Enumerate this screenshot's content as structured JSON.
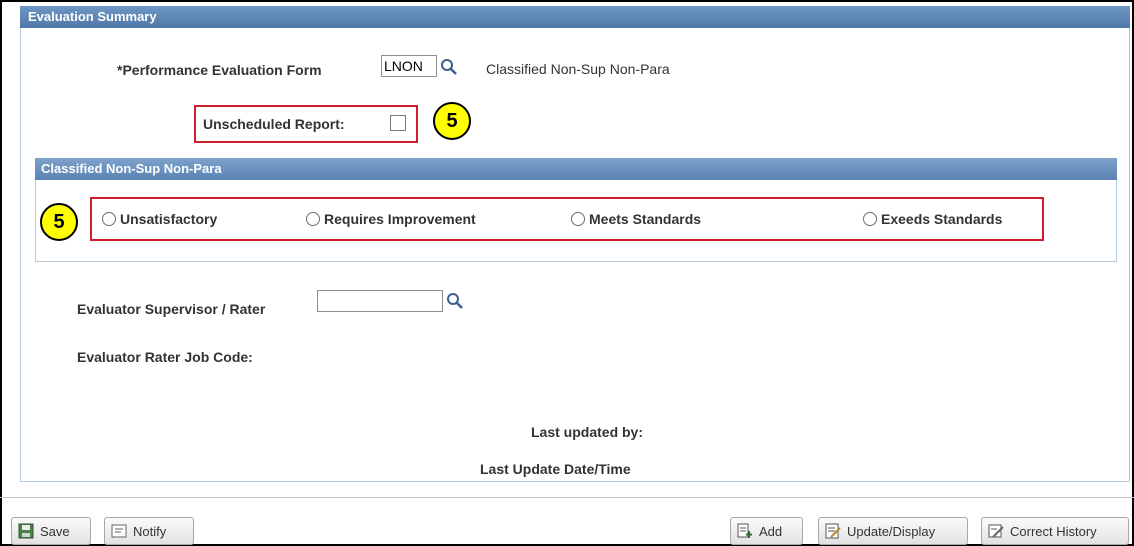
{
  "section": {
    "title": "Evaluation Summary"
  },
  "form": {
    "perf_eval_label": "*Performance Evaluation Form",
    "perf_eval_value": "LNON",
    "perf_eval_description": "Classified Non-Sup Non-Para",
    "unscheduled_label": "Unscheduled Report:",
    "unscheduled_checked": false
  },
  "callouts": {
    "first": "5",
    "second": "5"
  },
  "rating_group": {
    "title": "Classified Non-Sup Non-Para",
    "options": [
      {
        "label": "Unsatisfactory",
        "selected": false
      },
      {
        "label": "Requires Improvement",
        "selected": false
      },
      {
        "label": "Meets Standards",
        "selected": false
      },
      {
        "label": "Exeeds Standards",
        "selected": false
      }
    ]
  },
  "evaluator": {
    "supervisor_label": "Evaluator Supervisor / Rater",
    "supervisor_value": "",
    "job_code_label": "Evaluator Rater Job Code:"
  },
  "audit": {
    "last_updated_by_label": "Last updated by:",
    "last_update_datetime_label": "Last Update Date/Time"
  },
  "toolbar": {
    "save_label": "Save",
    "notify_label": "Notify",
    "add_label": "Add",
    "update_display_label": "Update/Display",
    "correct_history_label": "Correct History"
  },
  "colors": {
    "header_blue": "#4f78aa",
    "highlight_red": "#cc1e2b",
    "callout_yellow": "#ffff00"
  }
}
